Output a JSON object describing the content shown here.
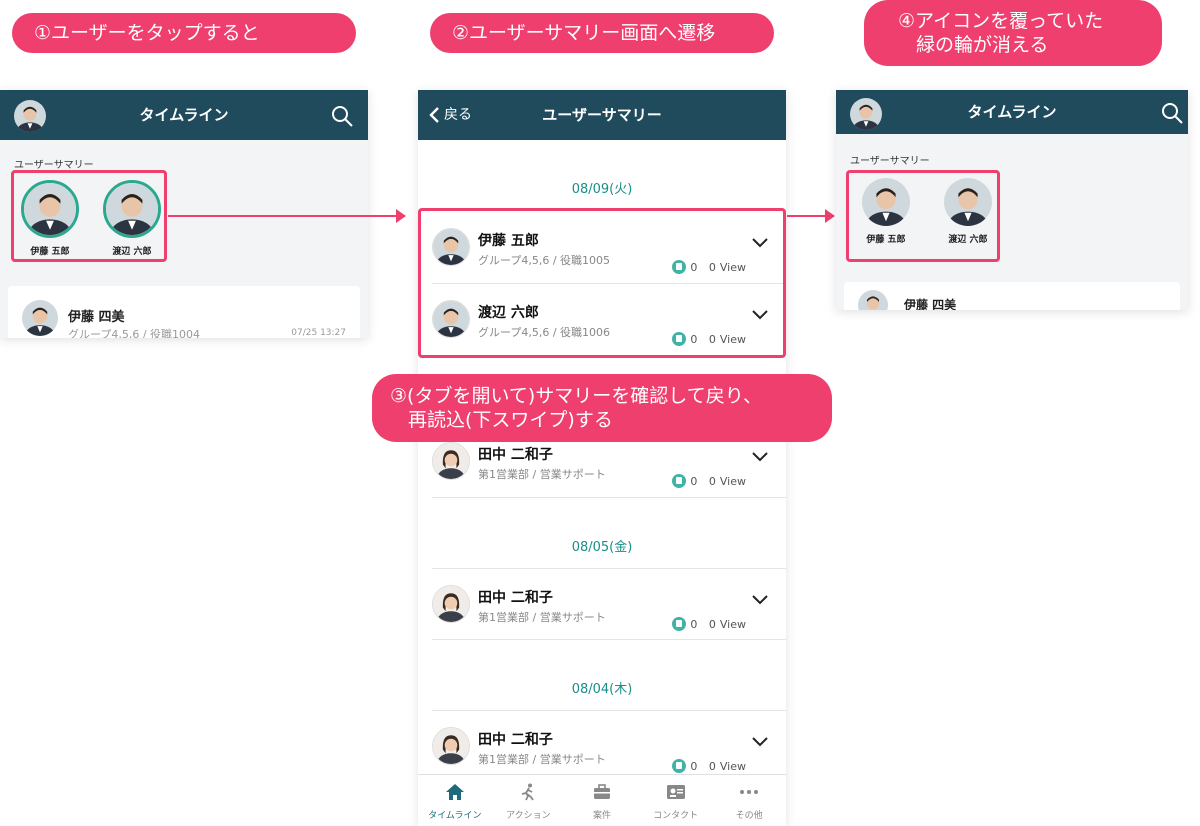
{
  "callouts": {
    "step1": "①ユーザーをタップすると",
    "step2": "②ユーザーサマリー画面へ遷移",
    "step3_line1": "③(タブを開いて)サマリーを確認して戻り、",
    "step3_line2": "再読込(下スワイプ)する",
    "step4_line1": "④アイコンを覆っていた",
    "step4_line2": "緑の輪が消える"
  },
  "screen1": {
    "title": "タイムライン",
    "summary_label": "ユーザーサマリー",
    "users": [
      "伊藤 五郎",
      "渡辺 六郎"
    ],
    "feed": {
      "name": "伊藤 四美",
      "dept": "グループ4,5,6 / 役職1004",
      "time": "07/25 13:27"
    }
  },
  "screen2": {
    "back": "戻る",
    "title": "ユーザーサマリー",
    "dates": [
      "08/09(火)",
      "08/05(金)",
      "08/04(木)"
    ],
    "rows": [
      {
        "name": "伊藤 五郎",
        "dept": "グループ4,5,6 / 役職1005",
        "likes": "0",
        "views": "0",
        "views_label": "View"
      },
      {
        "name": "渡辺 六郎",
        "dept": "グループ4,5,6 / 役職1006",
        "likes": "0",
        "views": "0",
        "views_label": "View"
      },
      {
        "name": "田中 二和子",
        "dept": "第1営業部 / 営業サポート",
        "likes": "0",
        "views": "0",
        "views_label": "View"
      },
      {
        "name": "田中 二和子",
        "dept": "第1営業部 / 営業サポート",
        "likes": "0",
        "views": "0",
        "views_label": "View"
      },
      {
        "name": "田中 二和子",
        "dept": "第1営業部 / 営業サポート",
        "likes": "0",
        "views": "0",
        "views_label": "View"
      }
    ],
    "tabs": [
      "タイムライン",
      "アクション",
      "案件",
      "コンタクト",
      "その他"
    ]
  },
  "screen3": {
    "title": "タイムライン",
    "summary_label": "ユーザーサマリー",
    "users": [
      "伊藤 五郎",
      "渡辺 六郎"
    ],
    "feed_name": "伊藤 四美"
  },
  "colors": {
    "accent": "#ee3f6e",
    "nav": "#1f4b5c",
    "teal": "#1a8e8a"
  }
}
